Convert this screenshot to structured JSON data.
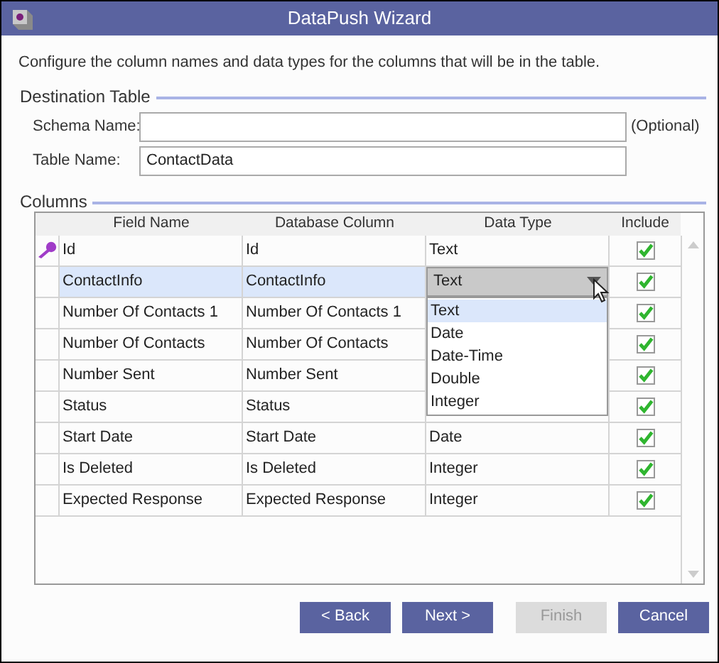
{
  "window": {
    "title": "DataPush Wizard"
  },
  "description": "Configure the column names and data types for the columns that will be in the table.",
  "destination": {
    "legend": "Destination Table",
    "schema": {
      "label": "Schema Name:",
      "note": "(Optional)"
    },
    "table": {
      "label": "Table Name:",
      "value": "ContactData"
    }
  },
  "columns": {
    "legend": "Columns",
    "headers": [
      "Field Name",
      "Database Column",
      "Data Type",
      "Include"
    ],
    "rows": [
      {
        "field": "Id",
        "column": "Id",
        "data_type": "Text",
        "include": true,
        "primary_key": true,
        "selected": false
      },
      {
        "field": "ContactInfo",
        "column": "ContactInfo",
        "include": true,
        "primary_key": false,
        "selected": true
      },
      {
        "field": "Number Of Contacts 1",
        "column": "Number Of Contacts 1",
        "include": true,
        "primary_key": false,
        "selected": false
      },
      {
        "field": "Number Of Contacts",
        "column": "Number Of Contacts",
        "include": true,
        "primary_key": false,
        "selected": false
      },
      {
        "field": "Number Sent",
        "column": "Number Sent",
        "include": true,
        "primary_key": false,
        "selected": false
      },
      {
        "field": "Status",
        "column": "Status",
        "include": true,
        "primary_key": false,
        "selected": false
      },
      {
        "field": "Start Date",
        "column": "Start Date",
        "data_type": "Date",
        "include": true,
        "primary_key": false,
        "selected": false
      },
      {
        "field": "Is Deleted",
        "column": "Is Deleted",
        "data_type": "Integer",
        "include": true,
        "primary_key": false,
        "selected": false
      },
      {
        "field": "Expected Response",
        "column": "Expected Response",
        "data_type": "Integer",
        "include": true,
        "primary_key": false,
        "selected": false
      }
    ],
    "dropdown": {
      "value": "Text",
      "options": [
        {
          "label": "Text",
          "selected": true
        },
        {
          "label": "Date",
          "selected": false
        },
        {
          "label": "Date-Time",
          "selected": false
        },
        {
          "label": "Double",
          "selected": false
        },
        {
          "label": "Integer",
          "selected": false
        }
      ]
    }
  },
  "buttons": [
    {
      "label": "< Back",
      "disabled": false
    },
    {
      "label": "Next >",
      "disabled": false
    },
    {
      "label": "Finish",
      "disabled": true
    },
    {
      "label": "Cancel",
      "disabled": false
    }
  ]
}
